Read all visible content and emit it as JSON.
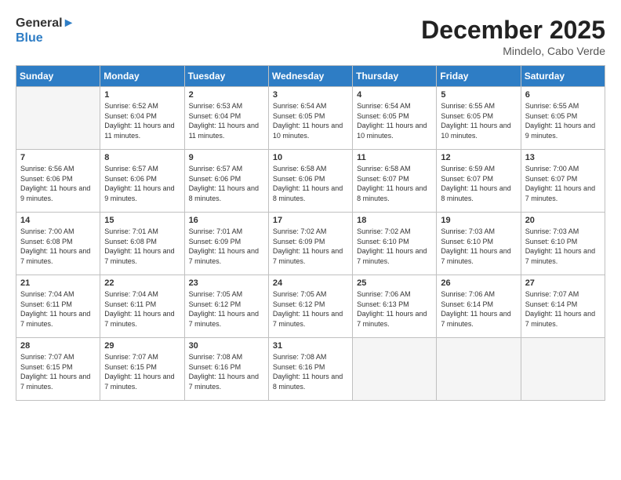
{
  "header": {
    "logo_general": "General",
    "logo_blue": "Blue",
    "month_year": "December 2025",
    "location": "Mindelo, Cabo Verde"
  },
  "days_of_week": [
    "Sunday",
    "Monday",
    "Tuesday",
    "Wednesday",
    "Thursday",
    "Friday",
    "Saturday"
  ],
  "weeks": [
    [
      {
        "day": null,
        "empty": true
      },
      {
        "day": "1",
        "sunrise": "Sunrise: 6:52 AM",
        "sunset": "Sunset: 6:04 PM",
        "daylight": "Daylight: 11 hours and 11 minutes."
      },
      {
        "day": "2",
        "sunrise": "Sunrise: 6:53 AM",
        "sunset": "Sunset: 6:04 PM",
        "daylight": "Daylight: 11 hours and 11 minutes."
      },
      {
        "day": "3",
        "sunrise": "Sunrise: 6:54 AM",
        "sunset": "Sunset: 6:05 PM",
        "daylight": "Daylight: 11 hours and 10 minutes."
      },
      {
        "day": "4",
        "sunrise": "Sunrise: 6:54 AM",
        "sunset": "Sunset: 6:05 PM",
        "daylight": "Daylight: 11 hours and 10 minutes."
      },
      {
        "day": "5",
        "sunrise": "Sunrise: 6:55 AM",
        "sunset": "Sunset: 6:05 PM",
        "daylight": "Daylight: 11 hours and 10 minutes."
      },
      {
        "day": "6",
        "sunrise": "Sunrise: 6:55 AM",
        "sunset": "Sunset: 6:05 PM",
        "daylight": "Daylight: 11 hours and 9 minutes."
      }
    ],
    [
      {
        "day": "7",
        "sunrise": "Sunrise: 6:56 AM",
        "sunset": "Sunset: 6:06 PM",
        "daylight": "Daylight: 11 hours and 9 minutes."
      },
      {
        "day": "8",
        "sunrise": "Sunrise: 6:57 AM",
        "sunset": "Sunset: 6:06 PM",
        "daylight": "Daylight: 11 hours and 9 minutes."
      },
      {
        "day": "9",
        "sunrise": "Sunrise: 6:57 AM",
        "sunset": "Sunset: 6:06 PM",
        "daylight": "Daylight: 11 hours and 8 minutes."
      },
      {
        "day": "10",
        "sunrise": "Sunrise: 6:58 AM",
        "sunset": "Sunset: 6:06 PM",
        "daylight": "Daylight: 11 hours and 8 minutes."
      },
      {
        "day": "11",
        "sunrise": "Sunrise: 6:58 AM",
        "sunset": "Sunset: 6:07 PM",
        "daylight": "Daylight: 11 hours and 8 minutes."
      },
      {
        "day": "12",
        "sunrise": "Sunrise: 6:59 AM",
        "sunset": "Sunset: 6:07 PM",
        "daylight": "Daylight: 11 hours and 8 minutes."
      },
      {
        "day": "13",
        "sunrise": "Sunrise: 7:00 AM",
        "sunset": "Sunset: 6:07 PM",
        "daylight": "Daylight: 11 hours and 7 minutes."
      }
    ],
    [
      {
        "day": "14",
        "sunrise": "Sunrise: 7:00 AM",
        "sunset": "Sunset: 6:08 PM",
        "daylight": "Daylight: 11 hours and 7 minutes."
      },
      {
        "day": "15",
        "sunrise": "Sunrise: 7:01 AM",
        "sunset": "Sunset: 6:08 PM",
        "daylight": "Daylight: 11 hours and 7 minutes."
      },
      {
        "day": "16",
        "sunrise": "Sunrise: 7:01 AM",
        "sunset": "Sunset: 6:09 PM",
        "daylight": "Daylight: 11 hours and 7 minutes."
      },
      {
        "day": "17",
        "sunrise": "Sunrise: 7:02 AM",
        "sunset": "Sunset: 6:09 PM",
        "daylight": "Daylight: 11 hours and 7 minutes."
      },
      {
        "day": "18",
        "sunrise": "Sunrise: 7:02 AM",
        "sunset": "Sunset: 6:10 PM",
        "daylight": "Daylight: 11 hours and 7 minutes."
      },
      {
        "day": "19",
        "sunrise": "Sunrise: 7:03 AM",
        "sunset": "Sunset: 6:10 PM",
        "daylight": "Daylight: 11 hours and 7 minutes."
      },
      {
        "day": "20",
        "sunrise": "Sunrise: 7:03 AM",
        "sunset": "Sunset: 6:10 PM",
        "daylight": "Daylight: 11 hours and 7 minutes."
      }
    ],
    [
      {
        "day": "21",
        "sunrise": "Sunrise: 7:04 AM",
        "sunset": "Sunset: 6:11 PM",
        "daylight": "Daylight: 11 hours and 7 minutes."
      },
      {
        "day": "22",
        "sunrise": "Sunrise: 7:04 AM",
        "sunset": "Sunset: 6:11 PM",
        "daylight": "Daylight: 11 hours and 7 minutes."
      },
      {
        "day": "23",
        "sunrise": "Sunrise: 7:05 AM",
        "sunset": "Sunset: 6:12 PM",
        "daylight": "Daylight: 11 hours and 7 minutes."
      },
      {
        "day": "24",
        "sunrise": "Sunrise: 7:05 AM",
        "sunset": "Sunset: 6:12 PM",
        "daylight": "Daylight: 11 hours and 7 minutes."
      },
      {
        "day": "25",
        "sunrise": "Sunrise: 7:06 AM",
        "sunset": "Sunset: 6:13 PM",
        "daylight": "Daylight: 11 hours and 7 minutes."
      },
      {
        "day": "26",
        "sunrise": "Sunrise: 7:06 AM",
        "sunset": "Sunset: 6:14 PM",
        "daylight": "Daylight: 11 hours and 7 minutes."
      },
      {
        "day": "27",
        "sunrise": "Sunrise: 7:07 AM",
        "sunset": "Sunset: 6:14 PM",
        "daylight": "Daylight: 11 hours and 7 minutes."
      }
    ],
    [
      {
        "day": "28",
        "sunrise": "Sunrise: 7:07 AM",
        "sunset": "Sunset: 6:15 PM",
        "daylight": "Daylight: 11 hours and 7 minutes."
      },
      {
        "day": "29",
        "sunrise": "Sunrise: 7:07 AM",
        "sunset": "Sunset: 6:15 PM",
        "daylight": "Daylight: 11 hours and 7 minutes."
      },
      {
        "day": "30",
        "sunrise": "Sunrise: 7:08 AM",
        "sunset": "Sunset: 6:16 PM",
        "daylight": "Daylight: 11 hours and 7 minutes."
      },
      {
        "day": "31",
        "sunrise": "Sunrise: 7:08 AM",
        "sunset": "Sunset: 6:16 PM",
        "daylight": "Daylight: 11 hours and 8 minutes."
      },
      {
        "day": null,
        "empty": true
      },
      {
        "day": null,
        "empty": true
      },
      {
        "day": null,
        "empty": true
      }
    ]
  ]
}
